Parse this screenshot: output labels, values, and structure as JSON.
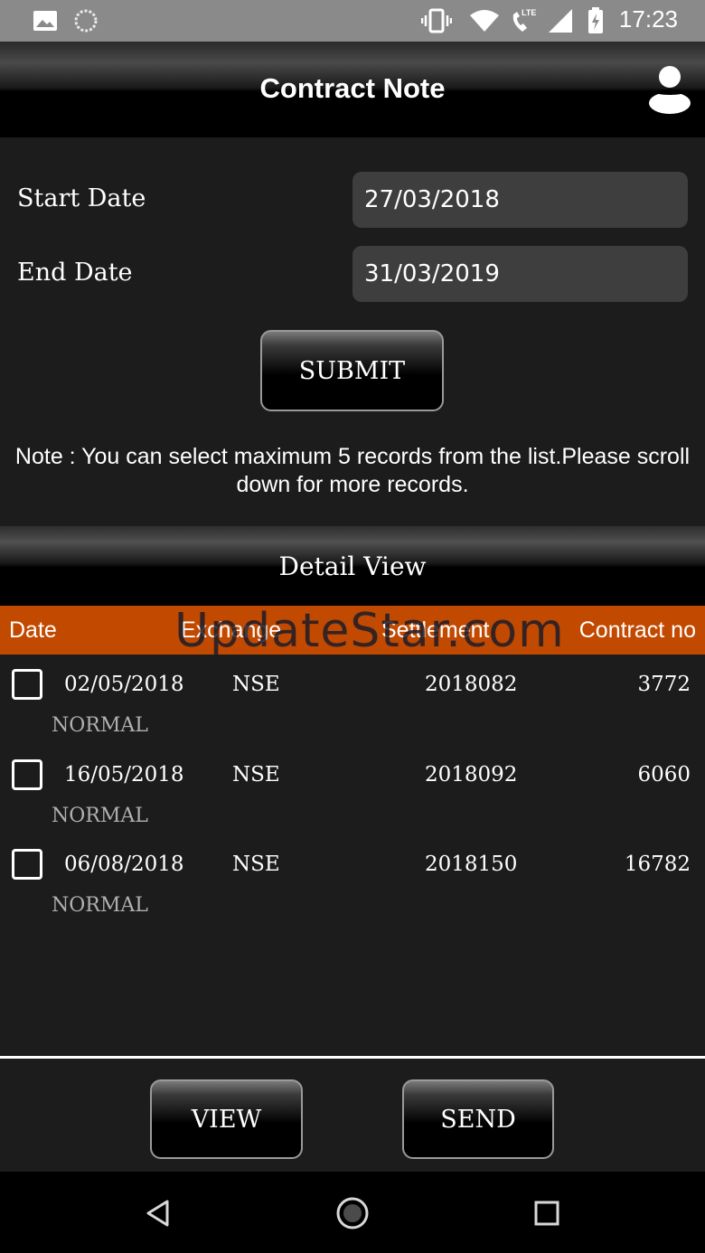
{
  "status_bar": {
    "time": "17:23",
    "icons": [
      "image-icon",
      "loading-icon",
      "vibrate-icon",
      "wifi-icon",
      "lte-call-icon",
      "signal-icon",
      "battery-icon"
    ]
  },
  "header": {
    "title": "Contract Note",
    "profile_icon": "user-icon"
  },
  "form": {
    "start_label": "Start Date",
    "start_value": "27/03/2018",
    "end_label": "End Date",
    "end_value": "31/03/2019",
    "submit_label": "SUBMIT"
  },
  "note": "Note : You can select maximum 5 records from the list.Please scroll down for more records.",
  "detail": {
    "title": "Detail View",
    "columns": [
      "Date",
      "Exchange",
      "Settlement",
      "Contract no"
    ],
    "rows": [
      {
        "date": "02/05/2018",
        "exchange": "NSE",
        "settlement": "2018082",
        "contract": "3772",
        "type": "NORMAL"
      },
      {
        "date": "16/05/2018",
        "exchange": "NSE",
        "settlement": "2018092",
        "contract": "6060",
        "type": "NORMAL"
      },
      {
        "date": "06/08/2018",
        "exchange": "NSE",
        "settlement": "2018150",
        "contract": "16782",
        "type": "NORMAL"
      }
    ]
  },
  "watermark": "UpdateStar.com",
  "actions": {
    "view_label": "VIEW",
    "send_label": "SEND"
  },
  "colors": {
    "header_accent": "#c14a00",
    "background": "#1c1c1c",
    "field_bg": "#3e3e3e"
  }
}
